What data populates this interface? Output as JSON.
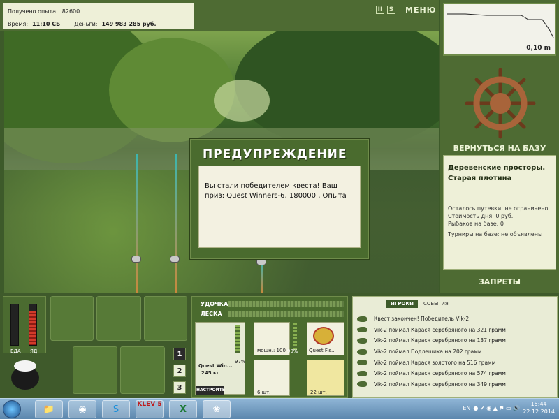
{
  "hud": {
    "exp_label": "Получено опыта:",
    "exp_value": "82600",
    "time_label": "Время:",
    "time_value": "11:10 СБ",
    "money_label": "Деньги:",
    "money_value": "149 983 285 руб.",
    "menu_label": "МЕНЮ",
    "pause_icon": "II",
    "s_icon": "S"
  },
  "depth": {
    "value": "0,10 m"
  },
  "base_button": "ВЕРНУТЬСЯ НА БАЗУ",
  "location": {
    "title": "Деревенские просторы. Старая плотина",
    "lines": [
      "Осталось путевки: не ограничено",
      "Стоимость дня: 0 руб.",
      "Рыбаков на базе: 0",
      "Турниры на базе: не объявлены"
    ]
  },
  "bans_button": "ЗАПРЕТЫ",
  "dialog": {
    "title": "ПРЕДУПРЕЖДЕНИЕ",
    "message": "Вы стали победителем квеста! Ваш приз: Quest Winners-6, 180000 , Опыта"
  },
  "meters": {
    "food_label": "ЕДА",
    "poison_label": "ЯД",
    "food_level": 0.0,
    "poison_level": 0.85
  },
  "pages": [
    "1",
    "2",
    "3"
  ],
  "tackle": {
    "rod_label": "УДОЧКА",
    "line_label": "ЛЕСКА",
    "rod_name": "Quest Win...",
    "rod_weight": "245 кг",
    "rod_percent": "97%",
    "reel_power": "мощн.: 100",
    "reel_percent": "99%",
    "line_name": "Quest Fis...",
    "hook_count": "6 шт.",
    "bait_count": "22 шт.",
    "setup_button": "НАСТРОИТЬ"
  },
  "log": {
    "tabs": [
      "ИГРОКИ",
      "СОБЫТИЯ"
    ],
    "entries": [
      "Квест закончен! Победитель Vik-2",
      "Vik-2 поймал Карася серебряного на 321 грамм",
      "Vik-2 поймал Карася серебряного на 137 грамм",
      "Vik-2 поймал Подлещика на 202 грамм",
      "Vik-2 поймал Карася золотого на 516 грамм",
      "Vik-2 поймал Карася серебряного на 574 грамм",
      "Vik-2 поймал Карася серебряного на 349 грамм"
    ]
  },
  "taskbar": {
    "lang": "EN",
    "time": "15:44",
    "date": "22.12.2014",
    "klev": "KLEV 5"
  },
  "colors": {
    "panel_green": "#4e6b33",
    "dark_green": "#3f5a2b",
    "panel_light": "#eef0d8"
  }
}
